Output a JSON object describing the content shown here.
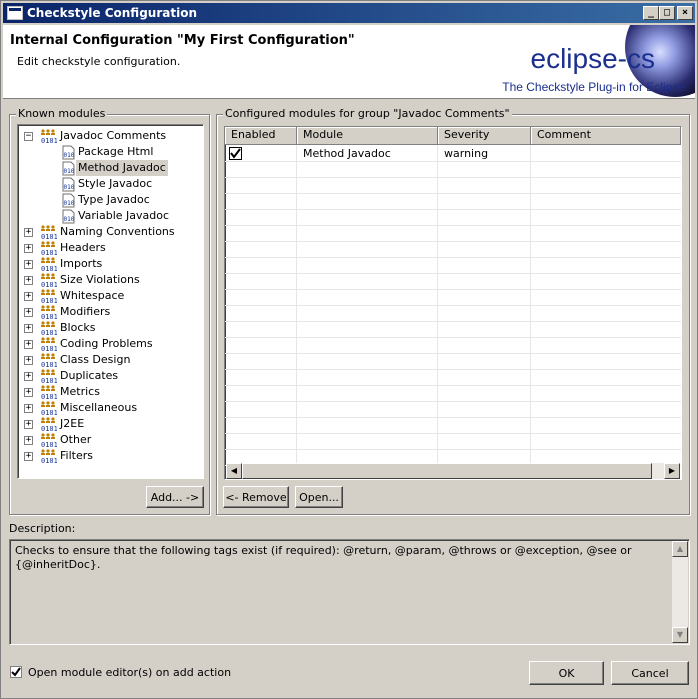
{
  "window": {
    "title": "Checkstyle Configuration",
    "minimize_label": "_",
    "maximize_label": "□",
    "close_label": "×"
  },
  "banner": {
    "title": "Internal Configuration \"My First Configuration\"",
    "subtitle": "Edit checkstyle configuration.",
    "logo_text": "eclipse-cs",
    "logo_tagline": "The Checkstyle Plug-in for Eclipse"
  },
  "known_modules": {
    "label": "Known modules",
    "tree": [
      {
        "label": "Javadoc Comments",
        "expanded": true,
        "children": [
          {
            "label": "Package Html"
          },
          {
            "label": "Method Javadoc",
            "selected": true
          },
          {
            "label": "Style Javadoc"
          },
          {
            "label": "Type Javadoc"
          },
          {
            "label": "Variable Javadoc"
          }
        ]
      },
      {
        "label": "Naming Conventions"
      },
      {
        "label": "Headers"
      },
      {
        "label": "Imports"
      },
      {
        "label": "Size Violations"
      },
      {
        "label": "Whitespace"
      },
      {
        "label": "Modifiers"
      },
      {
        "label": "Blocks"
      },
      {
        "label": "Coding Problems"
      },
      {
        "label": "Class Design"
      },
      {
        "label": "Duplicates"
      },
      {
        "label": "Metrics"
      },
      {
        "label": "Miscellaneous"
      },
      {
        "label": "J2EE"
      },
      {
        "label": "Other"
      },
      {
        "label": "Filters"
      }
    ],
    "add_button": "Add... ->"
  },
  "configured_modules": {
    "label": "Configured modules for group \"Javadoc Comments\"",
    "columns": [
      "Enabled",
      "Module",
      "Severity",
      "Comment"
    ],
    "rows": [
      {
        "enabled": true,
        "module": "Method Javadoc",
        "severity": "warning",
        "comment": ""
      }
    ],
    "remove_button": "<- Remove",
    "open_button": "Open..."
  },
  "description": {
    "label": "Description:",
    "text": "Checks to ensure that the following tags exist (if required): @return, @param, @throws or @exception, @see or {@inheritDoc}."
  },
  "footer": {
    "open_editor_label": "Open module editor(s) on add action",
    "open_editor_checked": true,
    "ok_button": "OK",
    "cancel_button": "Cancel"
  },
  "scroll": {
    "left_arrow": "◀",
    "right_arrow": "▶",
    "up_arrow": "▲",
    "down_arrow": "▼"
  }
}
